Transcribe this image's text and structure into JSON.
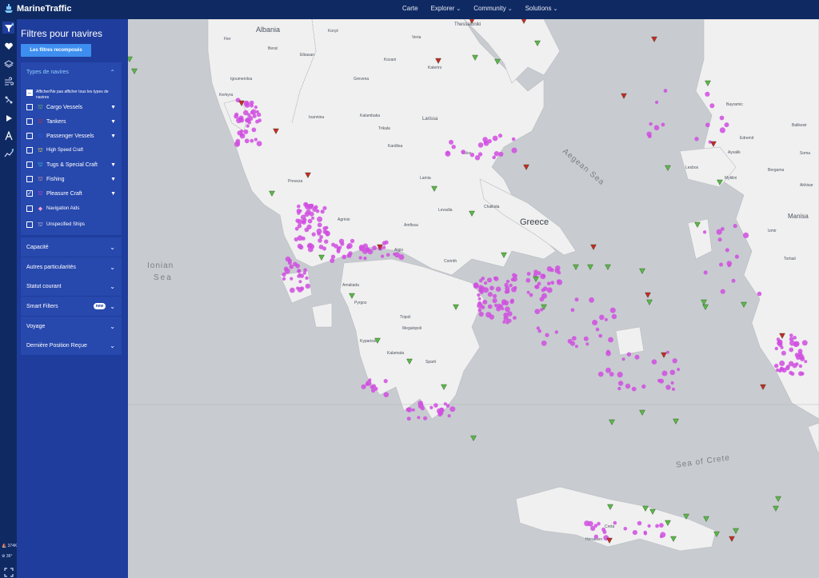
{
  "app": {
    "name": "MarineTraffic"
  },
  "nav": [
    "Carte",
    "Explorer",
    "Community",
    "Solutions"
  ],
  "panel": {
    "title": "Filtres pour navires",
    "button": "Les filtres recomposés",
    "types_header": "Types de navires",
    "check_all": "Afficher/Ne pas afficher tous les types de navires",
    "vessel_types": [
      {
        "label": "Cargo Vessels",
        "color": "#7ad14a",
        "checked": false
      },
      {
        "label": "Tankers",
        "color": "#e0302a",
        "checked": false
      },
      {
        "label": "Passenger Vessels",
        "color": "#2c64e8",
        "checked": false
      },
      {
        "label": "High Speed Craft",
        "color": "#f5e14b",
        "checked": false
      },
      {
        "label": "Tugs & Special Craft",
        "color": "#3bd0e0",
        "checked": false
      },
      {
        "label": "Fishing",
        "color": "#f49a8a",
        "checked": false
      },
      {
        "label": "Pleasure Craft",
        "color": "#e040e8",
        "checked": true
      },
      {
        "label": "Navigation Aids",
        "color": "#ff9ad0",
        "checked": false
      },
      {
        "label": "Unspecified Ships",
        "color": "#c8d0dc",
        "checked": false
      }
    ],
    "sections": [
      "Capacité",
      "Autres particularités",
      "Statut courant",
      "Smart Filters",
      "Voyage",
      "Dernière Position Reçue"
    ],
    "smart_badge": "new"
  },
  "status": {
    "vessels": "374K",
    "zoom": "36°"
  },
  "map_labels": {
    "albania": "Albania",
    "greece": "Greece",
    "ionian": "Ionian",
    "sea": "Sea",
    "aegean": "Aegean Sea",
    "crete": "Sea of Crete",
    "manisa": "Manisa",
    "larissa": "Larissa",
    "thessaloniki": "Thessaloniki",
    "ioannina": "Ioannina",
    "tripoli": "Tripoli",
    "lesbos": "Lesbos",
    "pyrgos": "Pyrgos",
    "kreta": "Creta",
    "korce": "Korçë",
    "berat": "Berat",
    "elbasan": "Elbasan",
    "fier": "Fier",
    "grevena": "Grevena",
    "kozani": "Kozani",
    "katerini": "Katerini",
    "veria": "Veria",
    "kalambaka": "Kalambaka",
    "trikala": "Trikala",
    "karditsa": "Karditsa",
    "volos": "Volos",
    "lamia": "Lamia",
    "megalopoli": "Megalopoli",
    "kalamata": "Kalamata",
    "sparti": "Sparti",
    "bergama": "Bergama",
    "balikesir": "Balikesir",
    "ayvalik": "Ayvalik",
    "torbali": "Torbali",
    "izmir": "Izmir",
    "agrinio": "Agrinio",
    "igoumenitsa": "Igoumenitsa",
    "preveza": "Preveza",
    "amfissa": "Amfissa",
    "aigio": "Aigio",
    "corinth": "Corinth",
    "amaliada": "Amaliada",
    "kyparissia": "Kyparissia",
    "kerkyra": "Kerkyra",
    "levadia": "Levadia",
    "chalkida": "Chalkida",
    "heraklion": "Heraklion",
    "bayramic": "Bayramic",
    "edremit": "Edremit",
    "soma": "Soma",
    "akhisar": "Akhisar",
    "mytilini": "Mytilini"
  },
  "colors": {
    "topbar": "#0f2a63",
    "panel": "#1f3d9c",
    "accent": "#3d8ef0",
    "water": "#c8ccd0",
    "land": "#f0f0f0",
    "pleasure": "#d04ee0",
    "cargo": "#5ab84a",
    "tanker": "#c8282a"
  }
}
